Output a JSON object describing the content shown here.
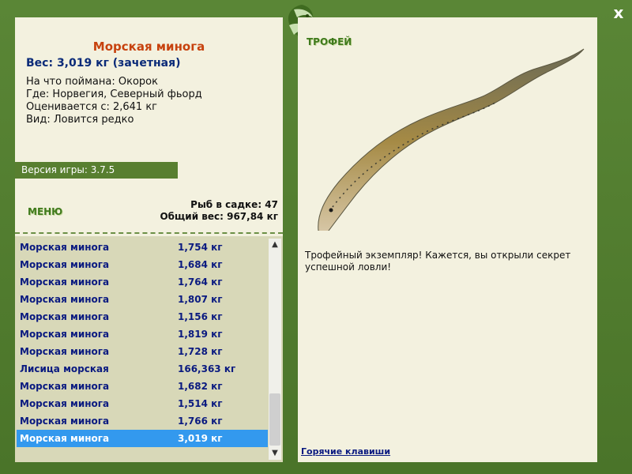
{
  "window": {
    "close_label": "x"
  },
  "catch": {
    "name": "Морская минога",
    "weight_line": "Вес: 3,019 кг (зачетная)",
    "bait_line": "На что поймана: Окорок",
    "location_line": "Где: Норвегия, Северный фьорд",
    "valued_line": "Оценивается с: 2,641 кг",
    "kind_line": "Вид: Ловится редко"
  },
  "version": "Версия игры: 3.7.5",
  "menu_title": "МЕНЮ",
  "stats": {
    "count_line": "Рыб в садке: 47",
    "total_line": "Общий вес: 967,84 кг"
  },
  "fish_list": [
    {
      "name": "Морская минога",
      "weight": "1,754 кг"
    },
    {
      "name": "Морская минога",
      "weight": "1,684 кг"
    },
    {
      "name": "Морская минога",
      "weight": "1,764 кг"
    },
    {
      "name": "Морская минога",
      "weight": "1,807 кг"
    },
    {
      "name": "Морская минога",
      "weight": "1,156 кг"
    },
    {
      "name": "Морская минога",
      "weight": "1,819 кг"
    },
    {
      "name": "Морская минога",
      "weight": "1,728 кг"
    },
    {
      "name": "Лисица морская",
      "weight": "166,363 кг"
    },
    {
      "name": "Морская минога",
      "weight": "1,682 кг"
    },
    {
      "name": "Морская минога",
      "weight": "1,514 кг"
    },
    {
      "name": "Морская минога",
      "weight": "1,766 кг"
    },
    {
      "name": "Морская минога",
      "weight": "3,019 кг",
      "selected": true
    }
  ],
  "trophy": {
    "title": "ТРОФЕЙ",
    "description": "Трофейный экземпляр! Кажется, вы открыли секрет успешной ловли!"
  },
  "hotkeys_link": "Горячие клавиши",
  "icons": {
    "close": "close-icon",
    "logo": "fish-logo-icon",
    "scroll_up": "scroll-up-arrow-icon",
    "scroll_down": "scroll-down-arrow-icon"
  },
  "colors": {
    "frame": "#4f7a2c",
    "panel": "#f3f1df",
    "list_bg": "#d8d8b8",
    "title_orange": "#c7420e",
    "text_blue": "#0a1a80",
    "selection": "#3399ee",
    "accent_green": "#3f7a1c"
  }
}
